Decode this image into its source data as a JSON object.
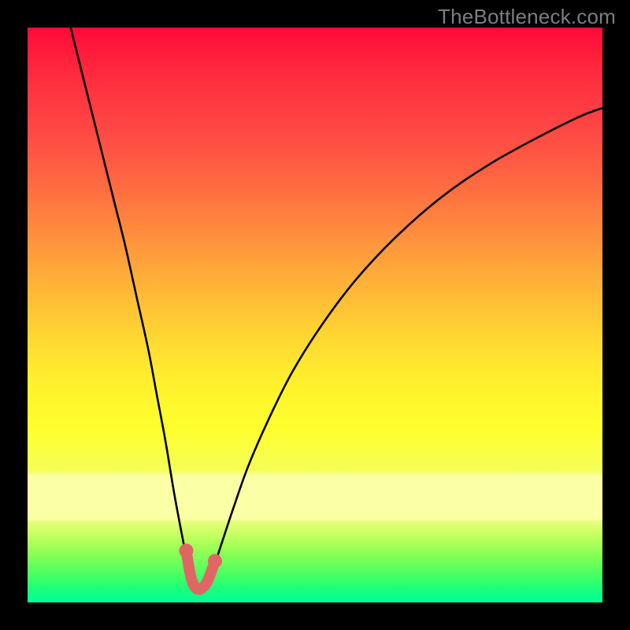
{
  "watermark": "TheBottleneck.com",
  "chart_data": {
    "type": "line",
    "title": "",
    "xlabel": "",
    "ylabel": "",
    "xlim": [
      0,
      100
    ],
    "ylim": [
      0,
      100
    ],
    "series": [
      {
        "name": "bottleneck-curve",
        "x": [
          7.5,
          9,
          11,
          13,
          15,
          17,
          19,
          21,
          22.5,
          24,
          25.5,
          27,
          28,
          28.8,
          29.6,
          30.4,
          31.2,
          32.5,
          34,
          36,
          38.5,
          42,
          46,
          51,
          57,
          64,
          72,
          80,
          88,
          96,
          100
        ],
        "y": [
          100,
          94,
          86,
          78,
          70,
          62,
          53,
          44,
          36,
          28,
          19,
          11,
          6,
          3.2,
          2.3,
          2.3,
          3.3,
          6.5,
          11,
          17,
          24,
          32,
          40,
          48,
          56,
          63.5,
          70.5,
          76,
          80.5,
          84.5,
          86
        ]
      },
      {
        "name": "bottom-highlight",
        "x": [
          27.6,
          28.2,
          28.8,
          29.4,
          30.0,
          30.6,
          31.2,
          31.9,
          32.6
        ],
        "y": [
          9.0,
          5.4,
          3.2,
          2.4,
          2.3,
          2.7,
          3.5,
          5.2,
          7.2
        ]
      }
    ],
    "gradient_stops": [
      {
        "pct": 0,
        "color": "#ff0a3a"
      },
      {
        "pct": 50,
        "color": "#ffc834"
      },
      {
        "pct": 70,
        "color": "#feff2e"
      },
      {
        "pct": 80,
        "color": "#fbffa6"
      },
      {
        "pct": 100,
        "color": "#07ff96"
      }
    ],
    "highlight_color": "#e06666",
    "curve_color": "#000000"
  }
}
